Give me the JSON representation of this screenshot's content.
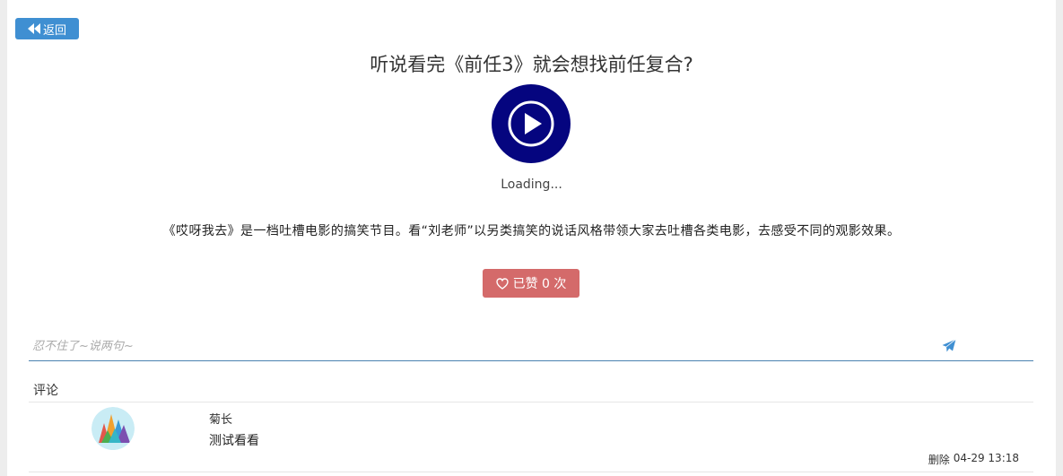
{
  "header": {
    "back_label": "返回"
  },
  "video": {
    "title": "听说看完《前任3》就会想找前任复合?",
    "loading_text": "Loading...",
    "description": "《哎呀我去》是一档吐槽电影的搞笑节目。看“刘老师”以另类搞笑的说话风格带领大家去吐槽各类电影，去感受不同的观影效果。"
  },
  "like": {
    "label": "已赞 0 次"
  },
  "comment_input": {
    "placeholder": "忍不住了~说两句~"
  },
  "comments": {
    "section_label": "评论",
    "items": [
      {
        "username": "菊长",
        "text": "测试看看",
        "delete_label": "删除",
        "time": "04-29 13:18"
      }
    ]
  },
  "colors": {
    "accent": "#3f8fd2",
    "player_bg": "#05057f",
    "like_bg": "#d46a6a",
    "input_border": "#4a82b0"
  },
  "icons": {
    "back": "backward-icon",
    "play": "play-circle-icon",
    "like": "heart-outline-icon",
    "send": "paper-plane-icon"
  }
}
